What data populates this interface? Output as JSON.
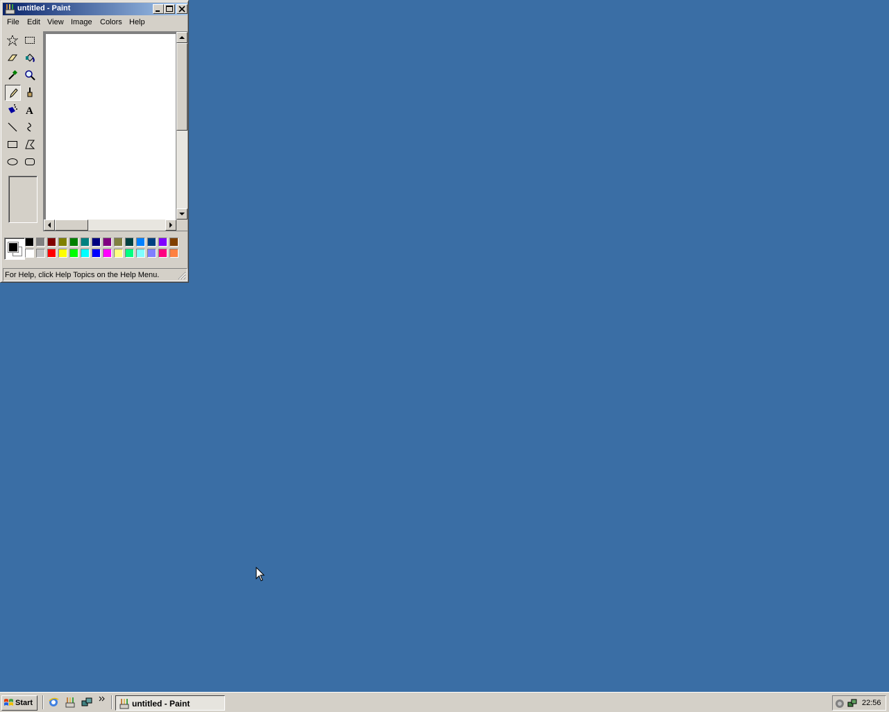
{
  "window": {
    "title": "untitled - Paint",
    "menu": [
      "File",
      "Edit",
      "View",
      "Image",
      "Colors",
      "Help"
    ],
    "status": "For Help, click Help Topics on the Help Menu."
  },
  "tools": [
    {
      "name": "free-form-select",
      "icon": "star-select-icon"
    },
    {
      "name": "select",
      "icon": "rect-select-icon"
    },
    {
      "name": "eraser",
      "icon": "eraser-icon"
    },
    {
      "name": "fill",
      "icon": "fill-bucket-icon"
    },
    {
      "name": "pick-color",
      "icon": "eyedropper-icon"
    },
    {
      "name": "magnifier",
      "icon": "magnifier-icon"
    },
    {
      "name": "pencil",
      "icon": "pencil-icon",
      "selected": true
    },
    {
      "name": "brush",
      "icon": "brush-icon"
    },
    {
      "name": "airbrush",
      "icon": "airbrush-icon"
    },
    {
      "name": "text",
      "icon": "text-icon"
    },
    {
      "name": "line",
      "icon": "line-icon"
    },
    {
      "name": "curve",
      "icon": "curve-icon"
    },
    {
      "name": "rectangle",
      "icon": "rectangle-icon"
    },
    {
      "name": "polygon",
      "icon": "polygon-icon"
    },
    {
      "name": "ellipse",
      "icon": "ellipse-icon"
    },
    {
      "name": "rounded-rectangle",
      "icon": "rounded-rect-icon"
    }
  ],
  "palette": {
    "foreground": "#000000",
    "background": "#ffffff",
    "top_row": [
      "#000000",
      "#808080",
      "#800000",
      "#808000",
      "#008000",
      "#008080",
      "#000080",
      "#800080",
      "#808040",
      "#004040",
      "#0080ff",
      "#004080",
      "#8000ff",
      "#804000"
    ],
    "bottom_row": [
      "#ffffff",
      "#c0c0c0",
      "#ff0000",
      "#ffff00",
      "#00ff00",
      "#00ffff",
      "#0000ff",
      "#ff00ff",
      "#ffff80",
      "#00ff80",
      "#80ffff",
      "#8080ff",
      "#ff0080",
      "#ff8040"
    ]
  },
  "taskbar": {
    "start_label": "Start",
    "task_label": "untitled - Paint",
    "clock": "22:56"
  },
  "colors": {
    "desktop": "#3a6ea5",
    "titlebar_start": "#0a246a",
    "titlebar_end": "#a6caf0"
  }
}
